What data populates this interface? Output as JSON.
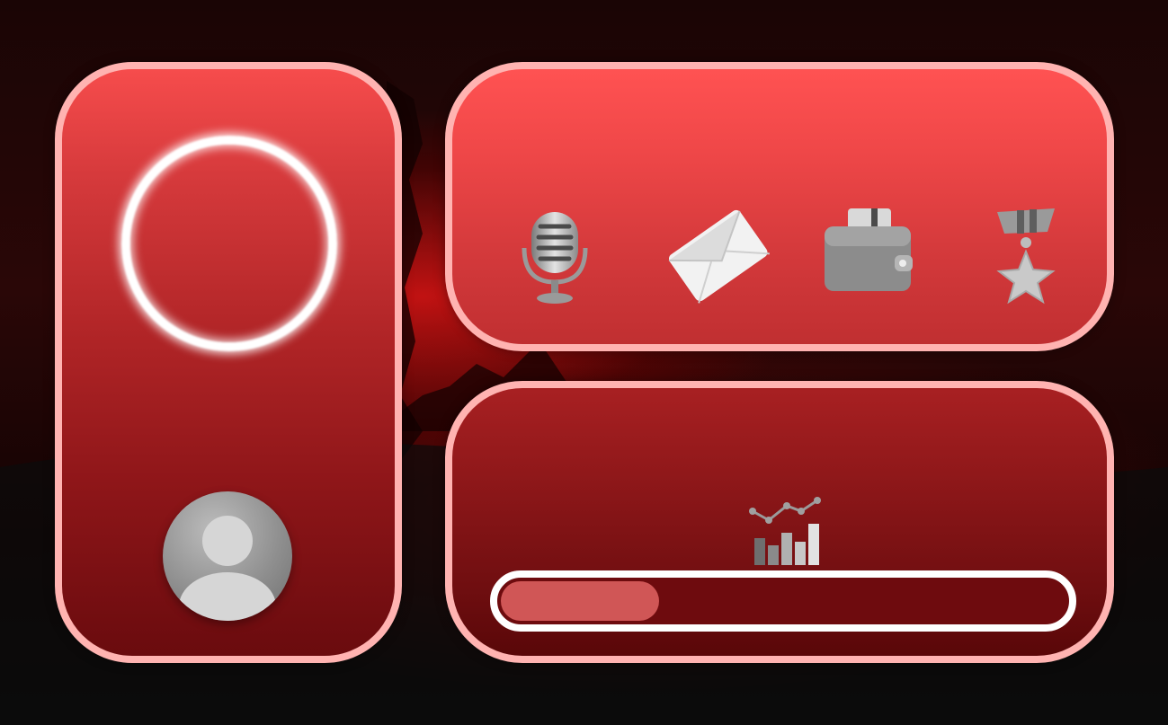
{
  "background": {
    "colors": {
      "sky_glow": "#dc1414",
      "dark": "#120303"
    }
  },
  "left_panel": {
    "border_color": "#ffb3b1",
    "ring_icon": "loading-ring-icon",
    "avatar_icon": "user-avatar-icon"
  },
  "top_panel": {
    "icons": [
      "microphone-icon",
      "envelope-icon",
      "wallet-icon",
      "medal-star-icon"
    ]
  },
  "bottom_panel": {
    "chart_icon": "bar-line-chart-icon",
    "progress": {
      "value": 0.28,
      "fill_color": "#d05656",
      "track_color": "#6e0b0e"
    }
  },
  "colors": {
    "panel_border": "#ffb3b1",
    "panel_red_top": "#ff5252",
    "panel_red_dark": "#6a0b0e"
  }
}
